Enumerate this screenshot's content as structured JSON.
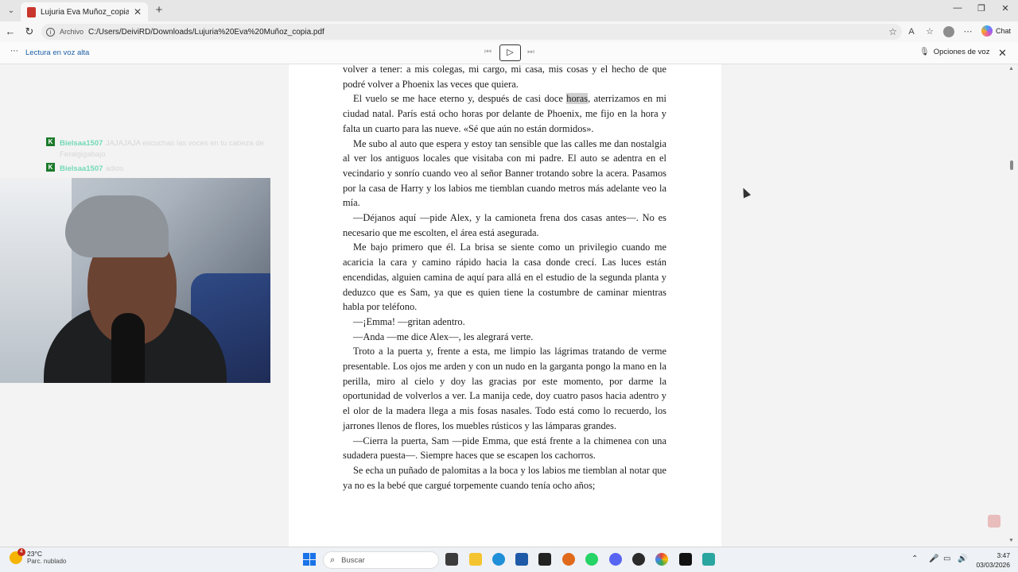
{
  "browser": {
    "tab_title": "Lujuria Eva Muñoz_copia.pdf",
    "address_scheme": "Archivo",
    "address_url": "C:/Users/DeiviRD/Downloads/Lujuria%20Eva%20Muñoz_copia.pdf",
    "chat_label": "Chat"
  },
  "read_aloud": {
    "label": "Lectura en voz alta",
    "voice_options": "Opciones de voz"
  },
  "document": {
    "paragraphs": [
      "volver a tener: a mis colegas, mi cargo, mi casa, mis cosas y el hecho de que podré volver a Phoenix las veces que quiera.",
      "El vuelo se me hace eterno y, después de casi doce ",
      "horas",
      ", aterrizamos en mi ciudad natal. París está ocho horas por delante de Phoenix, me fijo en la hora y falta un cuarto para las nueve. «Sé que aún no están dormidos».",
      "Me subo al auto que espera y estoy tan sensible que las calles me dan nostalgia al ver los antiguos locales que visitaba con mi padre. El auto se adentra en el vecindario y sonrío cuando veo al señor Banner trotando sobre la acera. Pasamos por la casa de Harry y los labios me tiemblan cuando metros más adelante veo la mía.",
      "—Déjanos aquí —pide Alex, y la camioneta frena dos casas antes—. No es necesario que me escolten, el área está asegurada.",
      "Me bajo primero que él. La brisa se siente como un privilegio cuando me acaricia la cara y camino rápido hacia la casa donde crecí. Las luces están encendidas, alguien camina de aquí para allá en el estudio de la segunda planta y deduzco que es Sam, ya que es quien tiene la costumbre de caminar mientras habla por teléfono.",
      "—¡Emma! —gritan adentro.",
      "—Anda —me dice Alex—, les alegrará verte.",
      "Troto a la puerta y, frente a esta, me limpio las lágrimas tratando de verme presentable. Los ojos me arden y con un nudo en la garganta pongo la mano en la perilla, miro al cielo y doy las gracias por este momento, por darme la oportunidad de volverlos a ver. La manija cede, doy cuatro pasos hacia adentro y el olor de la madera llega a mis fosas nasales. Todo está como lo recuerdo, los jarrones llenos de flores, los muebles rústicos y las lámparas grandes.",
      "—Cierra la puerta, Sam —pide Emma, que está frente a la chimenea con una sudadera puesta—. Siempre haces que se escapen los cachorros.",
      "Se echa un puñado de palomitas a la boca y los labios me tiemblan al notar que ya no es la bebé que cargué torpemente cuando tenía ocho años;"
    ]
  },
  "chat_overlay": {
    "messages": [
      {
        "user": "Bielsaa1507",
        "text": "JAJAJAJA escuchas las voces en tu cabeza de Feralgigabajo"
      },
      {
        "user": "Bielsaa1507",
        "text": "adios"
      }
    ]
  },
  "taskbar": {
    "weather_temp": "23°C",
    "weather_desc": "Parc. nublado",
    "weather_badge": "4",
    "search_placeholder": "Buscar",
    "time": "3:47",
    "date": "03/03/2026"
  }
}
